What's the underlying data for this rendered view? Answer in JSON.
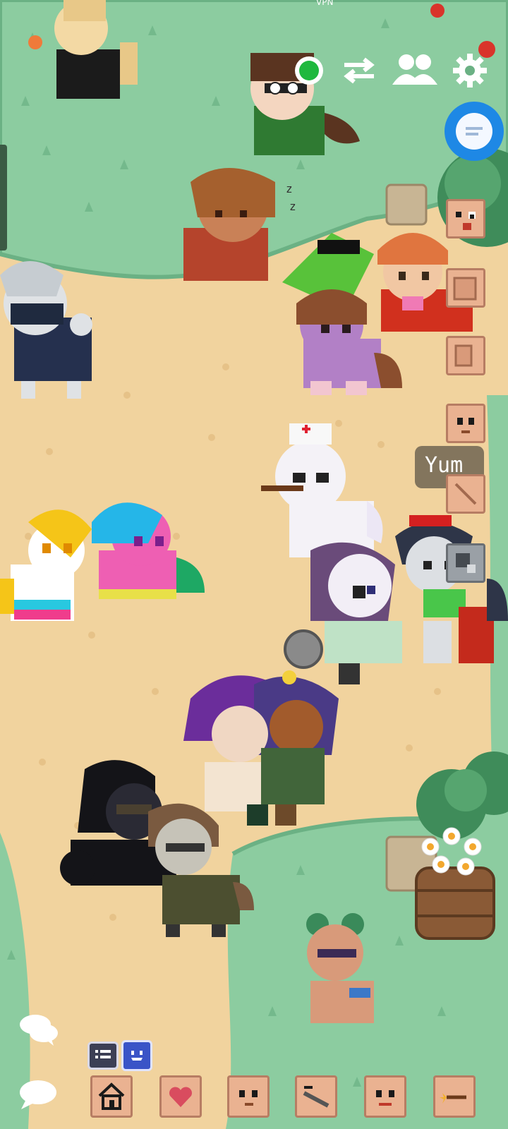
{
  "status_bar": {
    "vpn_label": "VPN"
  },
  "speech_bubbles": [
    {
      "text": "Yum"
    }
  ],
  "top_controls": {
    "online_status": "online",
    "icons": [
      "status-dot-icon",
      "swap-icon",
      "friends-icon",
      "settings-icon"
    ]
  },
  "chat_button": {
    "icon": "chat-bubble-icon"
  },
  "bottom_toolbar": {
    "icons": [
      "chat-log-icon",
      "emote-face-icon",
      "chat-icon",
      "whisper-icon",
      "home-icon",
      "heart-icon",
      "face-icon",
      "sword-icon",
      "face-icon",
      "wand-icon"
    ]
  },
  "colors": {
    "grass": "#8ccca0",
    "path": "#f1d39e",
    "accent": "#1e88e5"
  }
}
